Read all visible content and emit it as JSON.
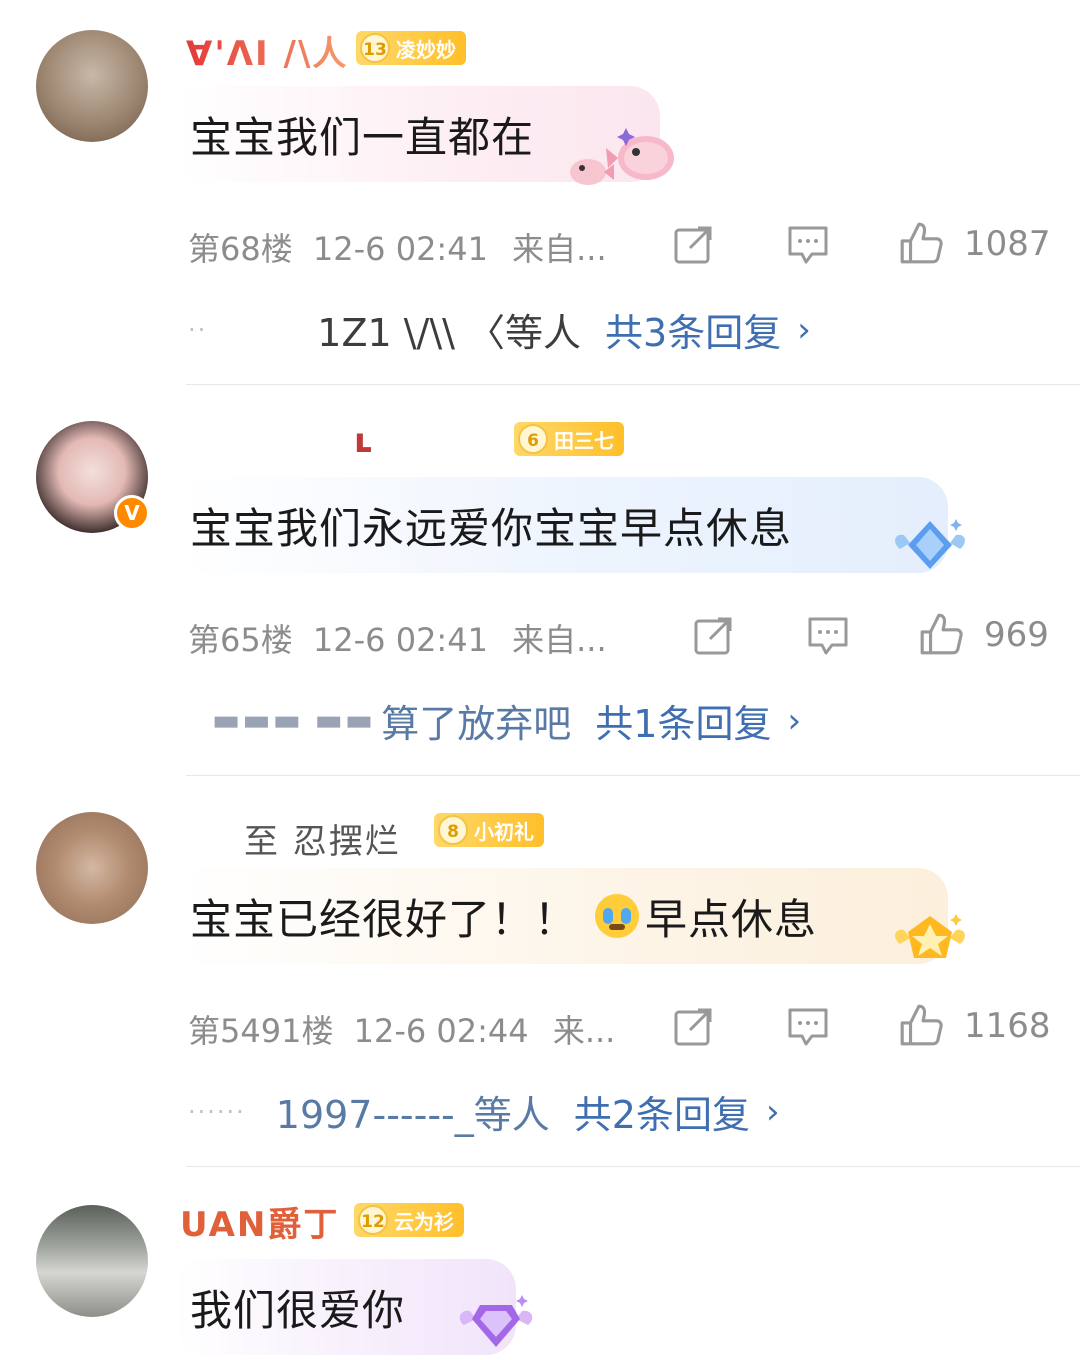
{
  "comments": [
    {
      "username": "Ɐ'ΛI /\\人",
      "fan_level": "13",
      "fan_name": "凌妙妙",
      "text": "宝宝我们一直都在",
      "floor": "第68楼",
      "time": "12-6 02:41",
      "source": "来自...",
      "likes": "1087",
      "reply_names": "1Z1 \\/\\\\ 〈等人",
      "reply_total": "共3条回复",
      "bubble_color": "#fdeef3"
    },
    {
      "username": "ʟ",
      "fan_level": "6",
      "fan_name": "田三七",
      "text": "宝宝我们永远爱你宝宝早点休息",
      "floor": "第65楼",
      "time": "12-6 02:41",
      "source": "来自...",
      "likes": "969",
      "reply_names": "算了放弃吧",
      "reply_total": "共1条回复",
      "bubble_color": "#eaf2fd"
    },
    {
      "username": "至 忍摆烂",
      "fan_level": "8",
      "fan_name": "小初礼",
      "text": "宝宝已经很好了！！",
      "text_tail": "早点休息",
      "floor": "第5491楼",
      "time": "12-6 02:44",
      "source": "来...",
      "likes": "1168",
      "reply_names": "1997------_等人",
      "reply_total": "共2条回复",
      "bubble_color": "#fdf3e4"
    },
    {
      "username": "UAN爵丁",
      "fan_level": "12",
      "fan_name": "云为衫",
      "text": "我们很爱你",
      "bubble_color": "#f6eefb"
    }
  ],
  "colors": {
    "link_blue": "#3f6fb0",
    "meta_gray": "#8c8c8c",
    "fan_badge_gold": "#ffc83a",
    "verified_orange": "#ff8a00"
  },
  "icons": [
    "share-icon",
    "comment-icon",
    "like-icon",
    "chevron-right-icon"
  ]
}
